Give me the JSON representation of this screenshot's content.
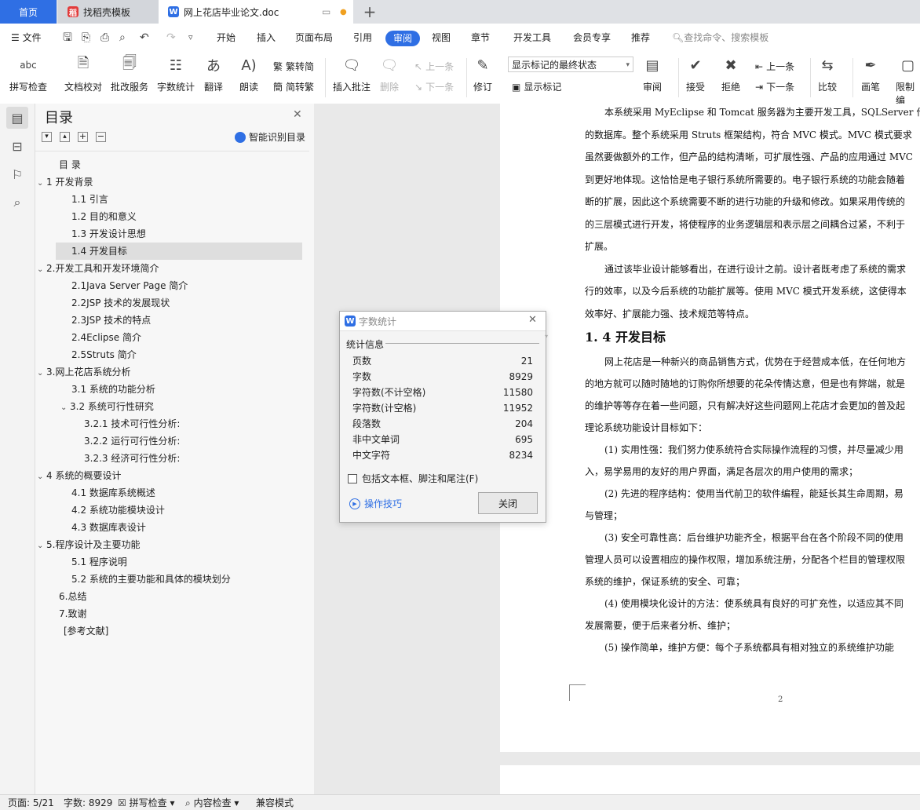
{
  "tabs": {
    "home": "首页",
    "templates": "找稻壳模板",
    "document": "网上花店毕业论文.doc"
  },
  "menu": {
    "file": "文件",
    "items": [
      "开始",
      "插入",
      "页面布局",
      "引用",
      "审阅",
      "视图",
      "章节",
      "开发工具",
      "会员专享",
      "推荐"
    ],
    "search_placeholder": "查找命令、搜索模板"
  },
  "ribbon": {
    "spell_check": "拼写检查",
    "doc_proof": "文档校对",
    "review_service": "批改服务",
    "word_count": "字数统计",
    "translate": "翻译",
    "read_aloud": "朗读",
    "trad_to_simp": "繁转简",
    "simp_to_trad": "简转繁",
    "insert_comment": "插入批注",
    "delete": "删除",
    "previous": "上一条",
    "next": "下一条",
    "track_changes": "修订",
    "markup_mode": "显示标记的最终状态",
    "show_markup": "显示标记",
    "review": "审阅",
    "accept": "接受",
    "reject": "拒绝",
    "prev_change": "上一条",
    "next_change": "下一条",
    "compare": "比较",
    "ink": "画笔",
    "restrict": "限制编"
  },
  "toc": {
    "title": "目录",
    "smart_toc": "智能识别目录",
    "items": [
      {
        "label": "目  录",
        "level": 0
      },
      {
        "label": "1  开发背景",
        "level": 1
      },
      {
        "label": "1.1 引言",
        "level": 2
      },
      {
        "label": "1.2 目的和意义",
        "level": 2
      },
      {
        "label": "1.3 开发设计思想",
        "level": 2
      },
      {
        "label": "1.4 开发目标",
        "level": 2
      },
      {
        "label": "2.开发工具和开发环境简介",
        "level": 1
      },
      {
        "label": "2.1Java Server Page  简介",
        "level": 2
      },
      {
        "label": "2.2JSP 技术的发展现状",
        "level": 2
      },
      {
        "label": "2.3JSP 技术的特点",
        "level": 2
      },
      {
        "label": "2.4Eclipse 简介",
        "level": 2
      },
      {
        "label": "2.5Struts 简介",
        "level": 2
      },
      {
        "label": "3.网上花店系统分析",
        "level": 1
      },
      {
        "label": "3.1 系统的功能分析",
        "level": 2
      },
      {
        "label": "3.2 系统可行性研究",
        "level": 2
      },
      {
        "label": "3.2.1 技术可行性分析:",
        "level": 3
      },
      {
        "label": "3.2.2 运行可行性分析:",
        "level": 3
      },
      {
        "label": "3.2.3 经济可行性分析:",
        "level": 3
      },
      {
        "label": "4 系统的概要设计",
        "level": 1
      },
      {
        "label": "4.1 数据库系统概述",
        "level": 2
      },
      {
        "label": "4.2 系统功能模块设计",
        "level": 2
      },
      {
        "label": "4.3 数据库表设计",
        "level": 2
      },
      {
        "label": "5.程序设计及主要功能",
        "level": 1
      },
      {
        "label": "5.1 程序说明",
        "level": 2
      },
      {
        "label": "5.2 系统的主要功能和具体的模块划分",
        "level": 2
      },
      {
        "label": "6.总结",
        "level": 1
      },
      {
        "label": "7.致谢",
        "level": 1
      },
      {
        "label": "[参考文献]",
        "level": 1
      }
    ]
  },
  "dialog": {
    "title": "字数统计",
    "section": "统计信息",
    "rows": [
      {
        "label": "页数",
        "value": "21"
      },
      {
        "label": "字数",
        "value": "8929"
      },
      {
        "label": "字符数(不计空格)",
        "value": "11580"
      },
      {
        "label": "字符数(计空格)",
        "value": "11952"
      },
      {
        "label": "段落数",
        "value": "204"
      },
      {
        "label": "非中文单词",
        "value": "695"
      },
      {
        "label": "中文字符",
        "value": "8234"
      }
    ],
    "checkbox_label": "包括文本框、脚注和尾注(F)",
    "tips": "操作技巧",
    "close": "关闭"
  },
  "document": {
    "lines": [
      "本系统采用 MyEclipse 和 Tomcat 服务器为主要开发工具，SQLServer 作为",
      "的数据库。整个系统采用 Struts 框架结构，符合 MVC 模式。MVC 模式要求",
      "虽然要做额外的工作，但产品的结构清晰，可扩展性强、产品的应用通过 MVC",
      "到更好地体现。这恰恰是电子银行系统所需要的。电子银行系统的功能会随着",
      "断的扩展，因此这个系统需要不断的进行功能的升级和修改。如果采用传统的",
      "的三层模式进行开发，将使程序的业务逻辑层和表示层之间耦合过紧，不利于",
      "扩展。",
      "通过该毕业设计能够看出，在进行设计之前。设计者既考虑了系统的需求",
      "行的效率，以及今后系统的功能扩展等。使用 MVC 模式开发系统，这使得本",
      "效率好、扩展能力强、技术规范等特点。"
    ],
    "heading": "1. 4 开发目标",
    "lines2": [
      "网上花店是一种新兴的商品销售方式，优势在于经营成本低，在任何地方",
      "的地方就可以随时随地的订购你所想要的花朵传情达意，但是也有弊端，就是",
      "的维护等等存在着一些问题，只有解决好这些问题网上花店才会更加的普及起",
      "理论系统功能设计目标如下：",
      "(1) 实用性强：我们努力使系统符合实际操作流程的习惯，并尽量减少用",
      "入，易学易用的友好的用户界面，满足各层次的用户使用的需求；",
      "(2) 先进的程序结构：使用当代前卫的软件编程，能延长其生命周期，易",
      "与管理；",
      "(3) 安全可靠性高：后台维护功能齐全，根据平台在各个阶段不同的使用",
      "管理人员可以设置相应的操作权限，增加系统注册，分配各个栏目的管理权限",
      "系统的维护，保证系统的安全、可靠；",
      "(4) 使用模块化设计的方法：使系统具有良好的可扩充性，以适应其不同",
      "发展需要，便于后来者分析、维护；",
      "(5) 操作简单，维护方便：每个子系统都具有相对独立的系统维护功能"
    ],
    "page_number": "2"
  },
  "status": {
    "page": "页面: 5/21",
    "words": "字数: 8929",
    "spell": "拼写检查",
    "content": "内容检查",
    "compat": "兼容模式"
  }
}
